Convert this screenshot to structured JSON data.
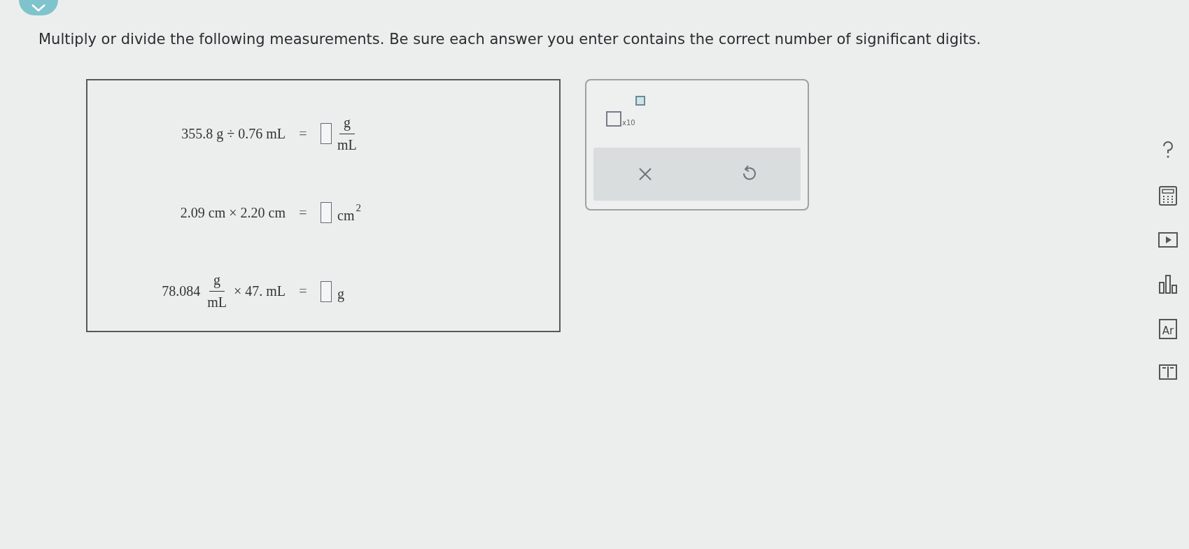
{
  "question": "Multiply or divide the following measurements. Be sure each answer you enter contains the correct number of significant digits.",
  "equations": [
    {
      "left": [
        {
          "kind": "text",
          "text": "355.8 g ÷ 0.76 mL"
        }
      ],
      "equals": "=",
      "right": [
        {
          "kind": "blank"
        },
        {
          "kind": "frac",
          "num": "g",
          "den": "mL"
        }
      ]
    },
    {
      "left": [
        {
          "kind": "text",
          "text": "2.09 cm × 2.20 cm"
        }
      ],
      "equals": "=",
      "right": [
        {
          "kind": "blank"
        },
        {
          "kind": "unit",
          "text": "cm",
          "sup": "2"
        }
      ]
    },
    {
      "left": [
        {
          "kind": "text",
          "text": "78.084"
        },
        {
          "kind": "frac",
          "num": "g",
          "den": "mL"
        },
        {
          "kind": "text",
          "text": "× 47. mL"
        }
      ],
      "equals": "=",
      "right": [
        {
          "kind": "blank"
        },
        {
          "kind": "unit",
          "text": "g"
        }
      ]
    }
  ],
  "keypad": {
    "exponent_label": "x10"
  },
  "tools": [
    {
      "kind": "help"
    },
    {
      "kind": "calculator"
    },
    {
      "kind": "video"
    },
    {
      "kind": "chart"
    },
    {
      "kind": "periodic",
      "label": "Ar"
    },
    {
      "kind": "book"
    }
  ]
}
